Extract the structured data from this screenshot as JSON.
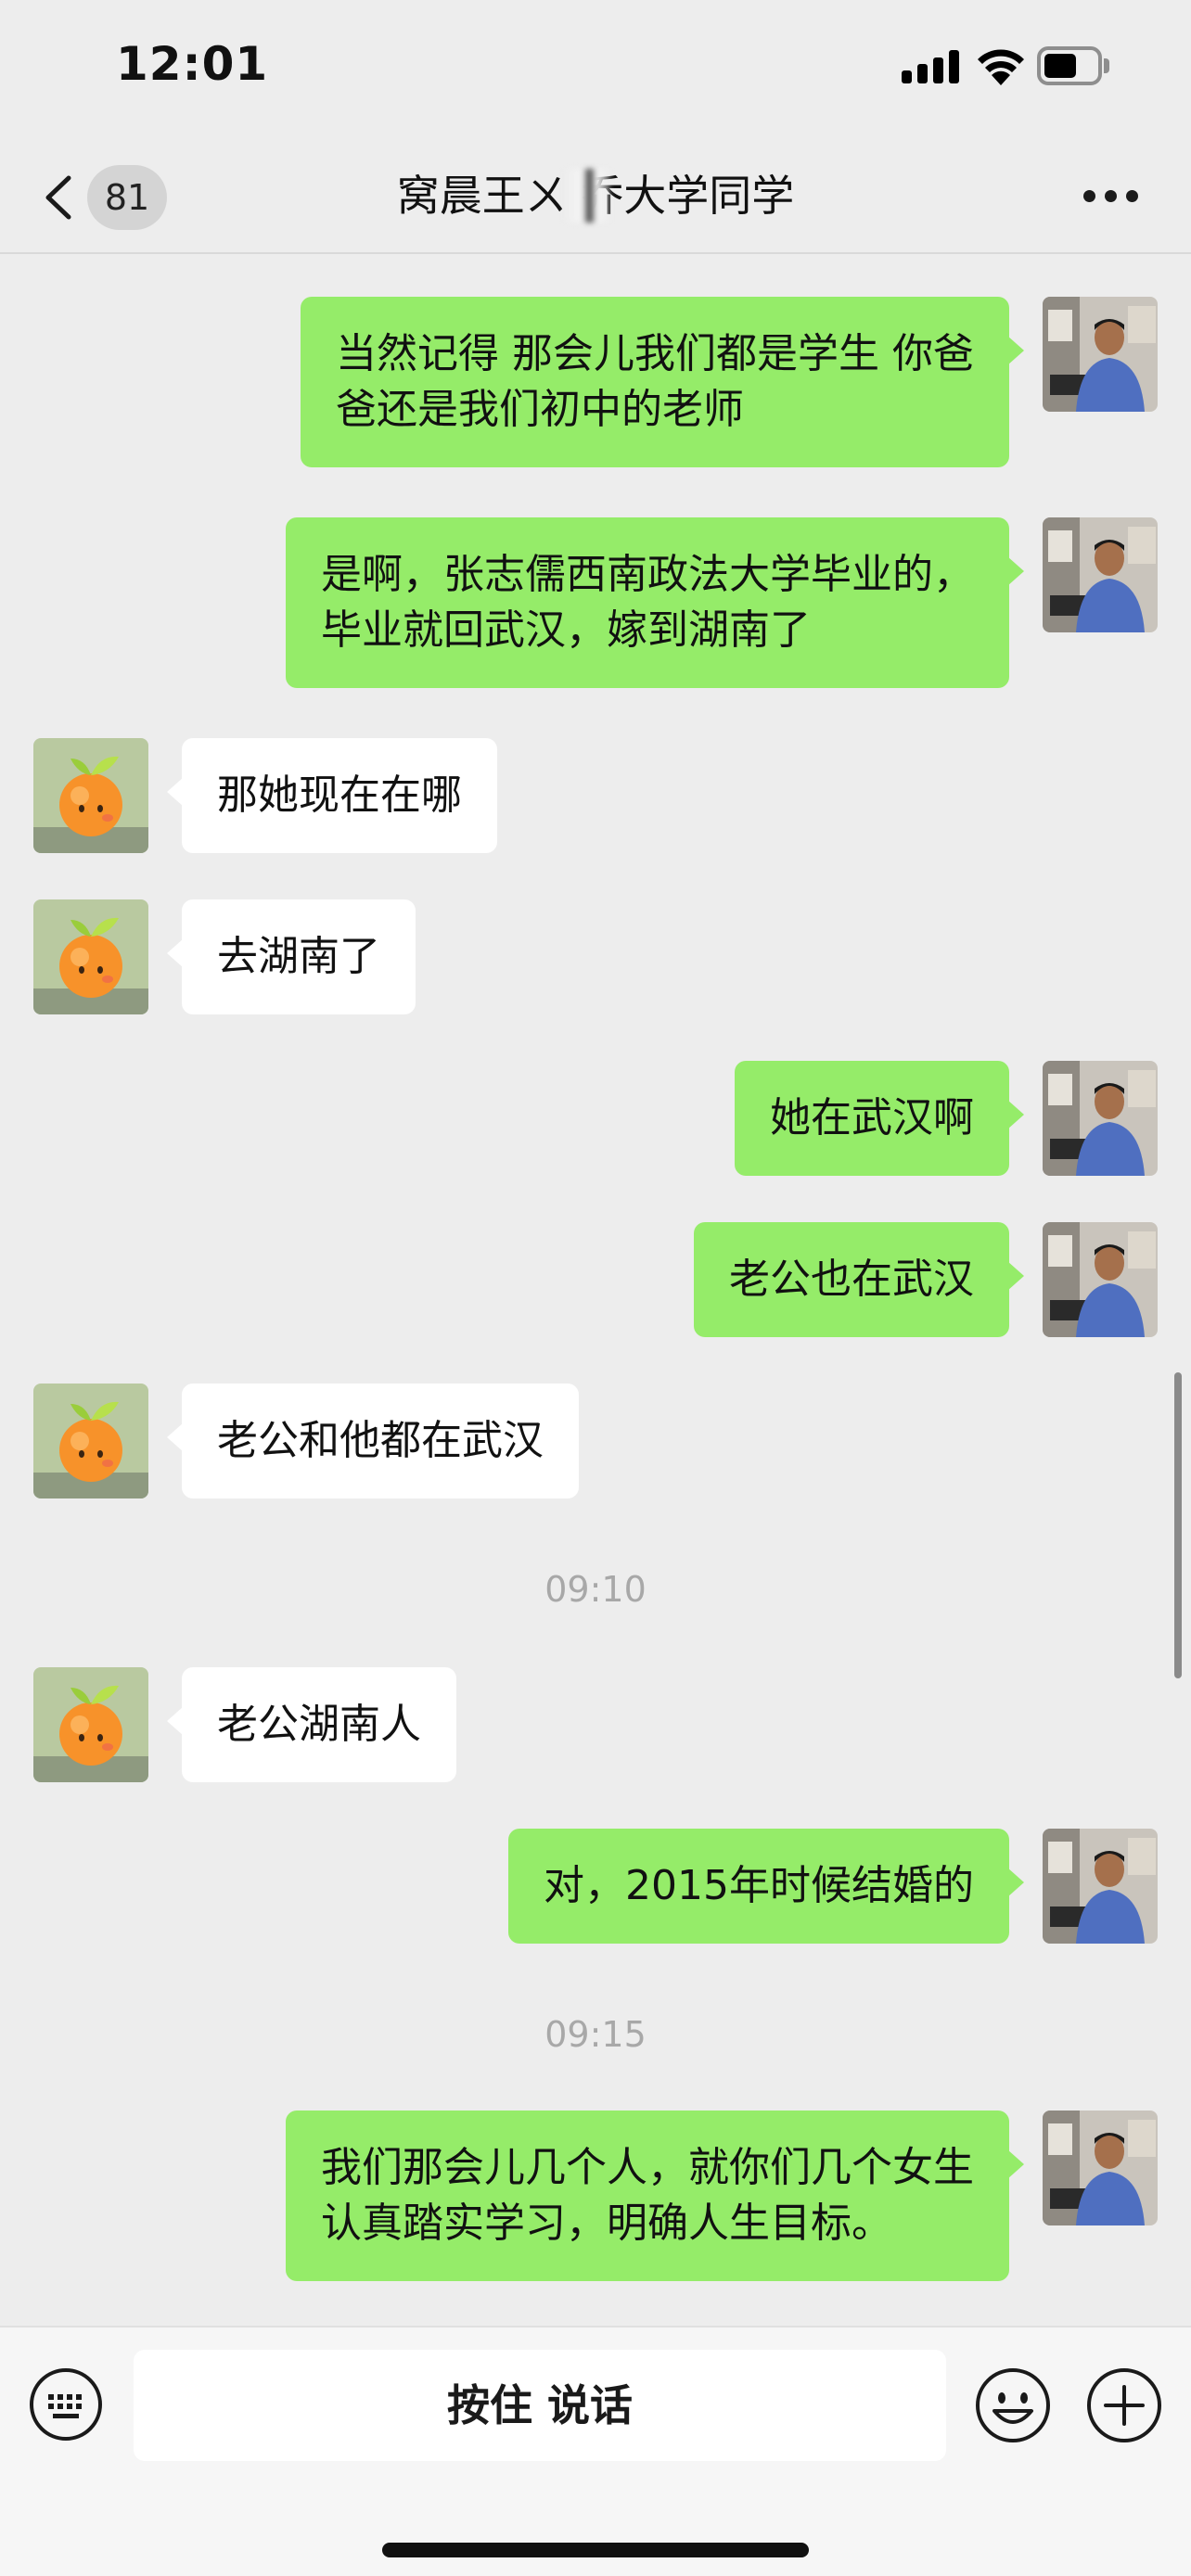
{
  "status_bar": {
    "time": "12:01",
    "icons": [
      "cellular-signal-icon",
      "wifi-icon",
      "battery-icon"
    ]
  },
  "nav": {
    "back_icon": "chevron-left-icon",
    "unread_count": "81",
    "title": "窝晨王ㄨ  乔大学同学",
    "more_icon": "more-dots-icon"
  },
  "colors": {
    "background": "#ededed",
    "outgoing_bubble": "#95ec69",
    "incoming_bubble": "#ffffff",
    "timestamp": "#a8a8a8"
  },
  "messages": [
    {
      "direction": "out",
      "lines": [
        "当然记得 那会儿我们都是学生 你爸",
        "爸还是我们初中的老师"
      ]
    },
    {
      "direction": "out",
      "lines": [
        "是啊，张志儒西南政法大学毕业的，",
        "毕业就回武汉，嫁到湖南了"
      ]
    },
    {
      "direction": "in",
      "lines": [
        "那她现在在哪"
      ]
    },
    {
      "direction": "in",
      "lines": [
        "去湖南了"
      ]
    },
    {
      "direction": "out",
      "lines": [
        "她在武汉啊"
      ]
    },
    {
      "direction": "out",
      "lines": [
        "老公也在武汉"
      ]
    },
    {
      "direction": "in",
      "lines": [
        "老公和他都在武汉"
      ]
    },
    {
      "direction": "time",
      "text": "09:10"
    },
    {
      "direction": "in",
      "lines": [
        "老公湖南人"
      ]
    },
    {
      "direction": "out",
      "lines": [
        "对，2015年时候结婚的"
      ]
    },
    {
      "direction": "time",
      "text": "09:15"
    },
    {
      "direction": "out",
      "lines": [
        "我们那会儿几个人，就你们几个女生",
        "认真踏实学习，明确人生目标。"
      ]
    }
  ],
  "input_bar": {
    "keyboard_icon": "keyboard-icon",
    "hold_to_talk": "按住 说话",
    "emoji_icon": "emoji-icon",
    "plus_icon": "plus-icon"
  }
}
